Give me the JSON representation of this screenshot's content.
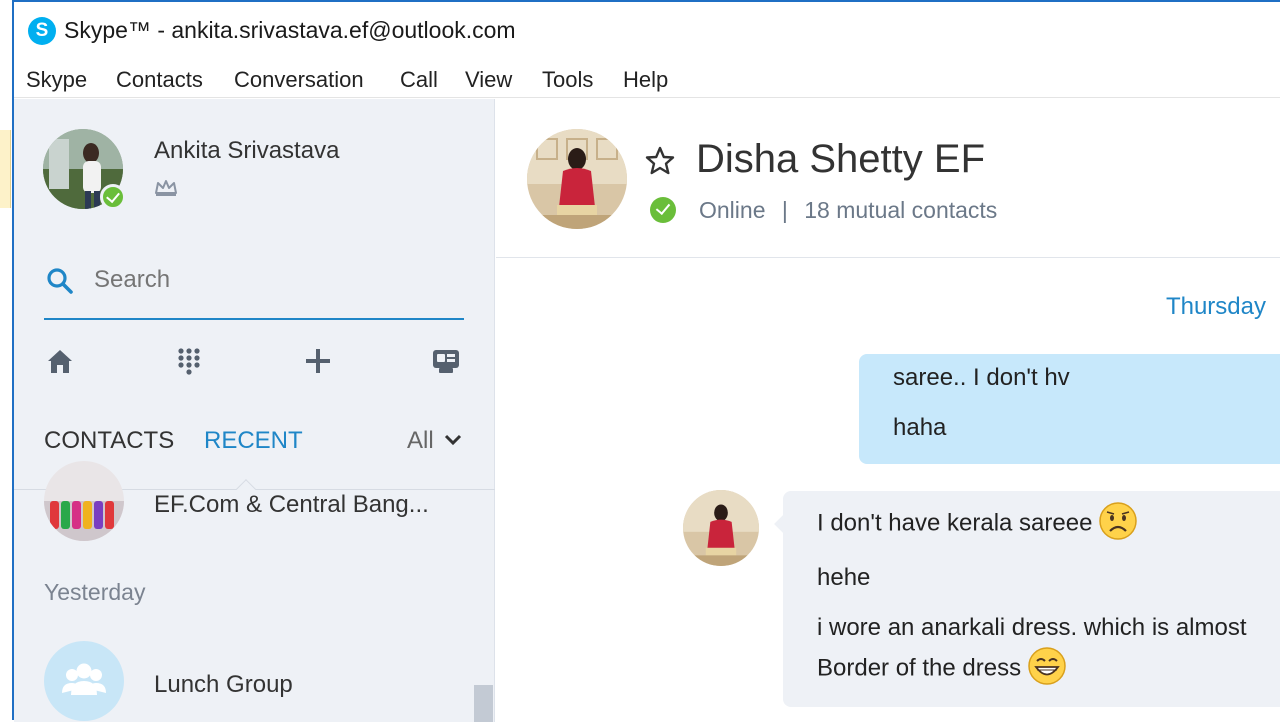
{
  "window": {
    "title": "Skype™ - ankita.srivastava.ef@outlook.com",
    "logo": "S"
  },
  "menu": [
    "Skype",
    "Contacts",
    "Conversation",
    "Call",
    "View",
    "Tools",
    "Help"
  ],
  "profile": {
    "name": "Ankita Srivastava",
    "status": "online",
    "badge_icon": "crown-icon"
  },
  "search": {
    "placeholder": "Search"
  },
  "toolbar": {
    "icons": [
      "home-icon",
      "dialpad-icon",
      "add-icon",
      "contact-card-icon"
    ]
  },
  "tabs": {
    "contacts": "CONTACTS",
    "recent": "RECENT",
    "filter": "All"
  },
  "recent": {
    "items": [
      {
        "name": "EF.Com & Central Bang..."
      },
      {
        "name": "Lunch Group"
      }
    ],
    "yesterday_label": "Yesterday"
  },
  "conversation": {
    "peer_name": "Disha Shetty EF",
    "peer_status": "Online",
    "separator": "|",
    "mutual": "18 mutual contacts",
    "day": "Thursday",
    "outgoing": [
      "saree.. I don't hv",
      "haha"
    ],
    "incoming": [
      "I don't have kerala sareee",
      "hehe",
      "i wore an anarkali dress. which is almost",
      "Border of the dress"
    ]
  },
  "colors": {
    "accent": "#1f86c7",
    "online": "#6abe3a",
    "sidebar_bg": "#eef1f6",
    "outgoing_bubble": "#c7e8fb",
    "incoming_bubble": "#eef1f6",
    "window_border": "#1f6fc4"
  }
}
